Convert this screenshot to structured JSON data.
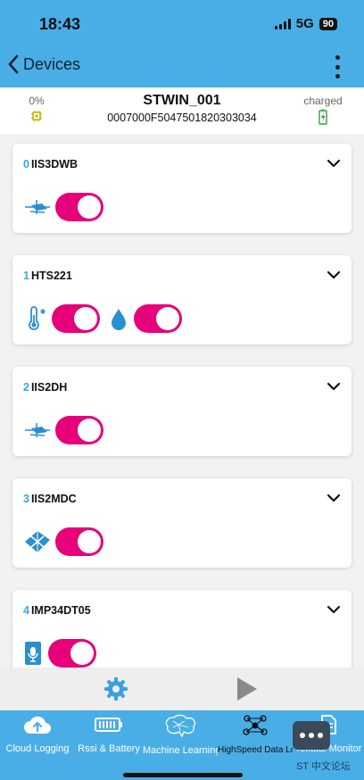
{
  "status_bar": {
    "time": "18:43",
    "network": "5G",
    "battery": "90"
  },
  "nav": {
    "back_label": "Devices"
  },
  "device": {
    "battery_percent": "0%",
    "name": "STWIN_001",
    "id": "0007000F5047501820303034",
    "charge_status": "charged"
  },
  "sensors": [
    {
      "index": "0",
      "name": "IIS3DWB",
      "icons": [
        "accelerometer-icon"
      ]
    },
    {
      "index": "1",
      "name": "HTS221",
      "icons": [
        "thermometer-icon",
        "humidity-drop-icon"
      ]
    },
    {
      "index": "2",
      "name": "IIS2DH",
      "icons": [
        "accelerometer-icon"
      ]
    },
    {
      "index": "3",
      "name": "IIS2MDC",
      "icons": [
        "magnetometer-icon"
      ]
    },
    {
      "index": "4",
      "name": "IMP34DT05",
      "icons": [
        "microphone-icon"
      ]
    }
  ],
  "tabs": [
    {
      "label": "Cloud Logging",
      "icon": "cloud-upload-icon"
    },
    {
      "label": "Rssi & Battery",
      "icon": "battery-icon"
    },
    {
      "label": "Machine Learning Co",
      "icon": "brain-icon"
    },
    {
      "label": "HighSpeed Data Log",
      "icon": "network-icon"
    },
    {
      "label": "Textual Monitor",
      "icon": "document-icon"
    }
  ],
  "watermark": "ST 中文论坛",
  "colors": {
    "accent": "#4aaee6",
    "toggle_on": "#e6007a",
    "index": "#36a6e8",
    "charge": "#2e9e3e",
    "chip": "#c8b400"
  }
}
